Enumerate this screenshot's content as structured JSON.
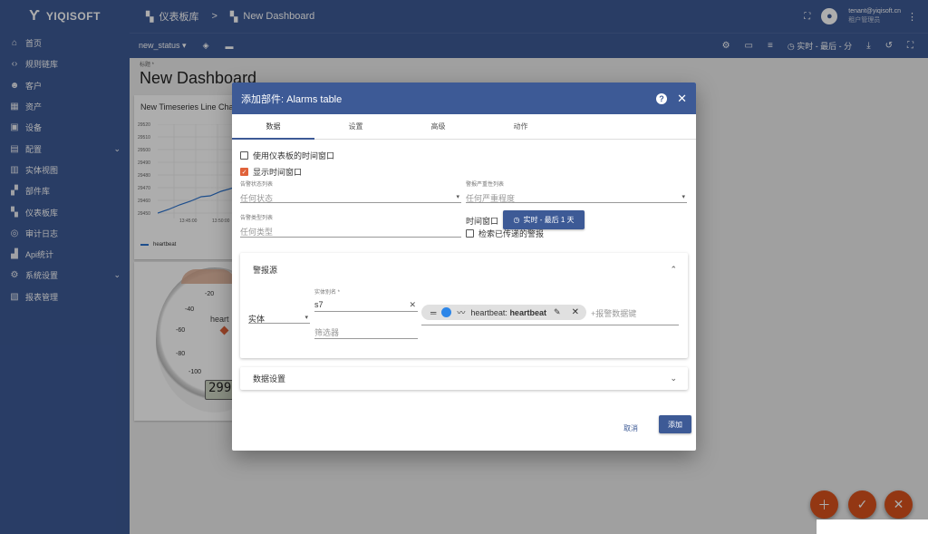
{
  "app": {
    "logo": "YIQISOFT"
  },
  "sidebar": {
    "items": [
      {
        "label": "首页",
        "icon": "home-icon"
      },
      {
        "label": "规则链库",
        "icon": "code-icon"
      },
      {
        "label": "客户",
        "icon": "people-icon"
      },
      {
        "label": "资产",
        "icon": "domain-icon"
      },
      {
        "label": "设备",
        "icon": "device-icon"
      },
      {
        "label": "配置",
        "icon": "config-icon"
      },
      {
        "label": "实体视图",
        "icon": "view-icon"
      },
      {
        "label": "部件库",
        "icon": "widgets-icon"
      },
      {
        "label": "仪表板库",
        "icon": "dashboard-icon"
      },
      {
        "label": "审计日志",
        "icon": "audit-icon"
      },
      {
        "label": "Api统计",
        "icon": "api-icon"
      },
      {
        "label": "系统设置",
        "icon": "settings-icon"
      },
      {
        "label": "报表管理",
        "icon": "report-icon"
      }
    ]
  },
  "header": {
    "breadcrumb_root": "仪表板库",
    "breadcrumb_current": "New Dashboard",
    "user_email": "tenant@yiqisoft.cn",
    "user_role": "租户管理员"
  },
  "toolbar": {
    "state": "new_status",
    "time_label": "实时 - 最后 - 分"
  },
  "dashboard": {
    "title_label": "标题 *",
    "title": "New Dashboard",
    "widget1_title": "New Timeseries Line Chart",
    "widget1_legend": "heartbeat",
    "widget1_yticks": [
      "29520",
      "29510",
      "29500",
      "29490",
      "29480",
      "29470",
      "29460",
      "29450"
    ],
    "widget1_xticks": [
      "13:45:00",
      "13:50:00"
    ],
    "gauge_ticks": [
      "-20",
      "-40",
      "-60",
      "-80",
      "-100"
    ],
    "gauge_label": "heart",
    "gauge_display": "299"
  },
  "dialog": {
    "title": "添加部件: Alarms table",
    "tabs": [
      "数据",
      "设置",
      "高级",
      "动作"
    ],
    "use_dashboard_timewindow": "使用仪表板的时间窗口",
    "show_timewindow": "显示时间窗口",
    "timewindow_label": "时间窗口",
    "timewindow_value": "实时 - 最后 1 天",
    "alarm_status_label": "告警状态列表",
    "alarm_status_placeholder": "任何状态",
    "alarm_severity_label": "警报严重性列表",
    "alarm_severity_placeholder": "任何严重程度",
    "alarm_type_label": "告警类型列表",
    "alarm_type_placeholder": "任何类型",
    "search_propagated": "检索已传递的警报",
    "alarm_source_title": "警报源",
    "source_type": "实体",
    "entity_alias_label": "实体别名 *",
    "entity_alias_value": "s7",
    "filter_placeholder": "筛选器",
    "chip_prefix": "heartbeat: ",
    "chip_bold": "heartbeat",
    "add_key": "+报警数据键",
    "data_settings_title": "数据设置",
    "cancel": "取消",
    "add": "添加"
  }
}
